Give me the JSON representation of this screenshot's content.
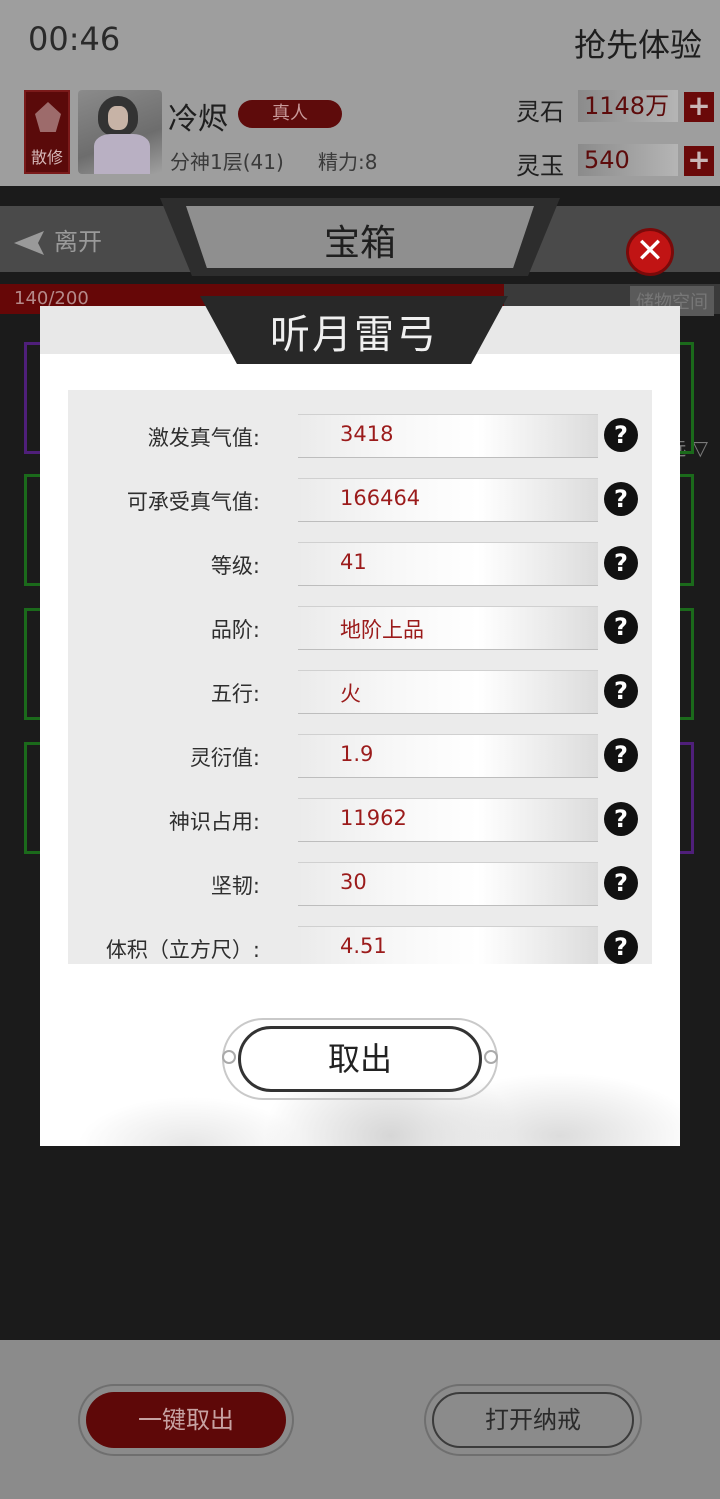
{
  "status": {
    "time": "00:46",
    "trial_label": "抢先体验"
  },
  "profile": {
    "sect_label": "散修",
    "name": "冷烬",
    "tag": "真人",
    "realm": "分神1层(41)",
    "energy": "精力:8",
    "spirit_stone_label": "灵石",
    "spirit_stone_value": "1148万",
    "spirit_jade_label": "灵玉",
    "spirit_jade_value": "540"
  },
  "nav": {
    "back_label": "离开",
    "page_title": "宝箱",
    "filter_label": "筛选"
  },
  "capacity": {
    "text": "140/200",
    "right_label": "储物空间",
    "fill_fraction": 0.7
  },
  "modal": {
    "title": "听月雷弓",
    "stats": [
      {
        "label": "激发真气值:",
        "value": "3418"
      },
      {
        "label": "可承受真气值:",
        "value": "166464"
      },
      {
        "label": "等级:",
        "value": "41"
      },
      {
        "label": "品阶:",
        "value": "地阶上品"
      },
      {
        "label": "五行:",
        "value": "火"
      },
      {
        "label": "灵衍值:",
        "value": "1.9"
      },
      {
        "label": "神识占用:",
        "value": "11962"
      },
      {
        "label": "坚韧:",
        "value": "30"
      },
      {
        "label": "体积（立方尺）:",
        "value": "4.51"
      }
    ],
    "help_glyph": "?",
    "close_glyph": "✕",
    "take_out_label": "取出"
  },
  "bottom": {
    "take_all_label": "一键取出",
    "open_ring_label": "打开纳戒"
  },
  "colors": {
    "accent_red": "#9b1b1b",
    "dark_red": "#5e0808",
    "close_red": "#c11414"
  }
}
